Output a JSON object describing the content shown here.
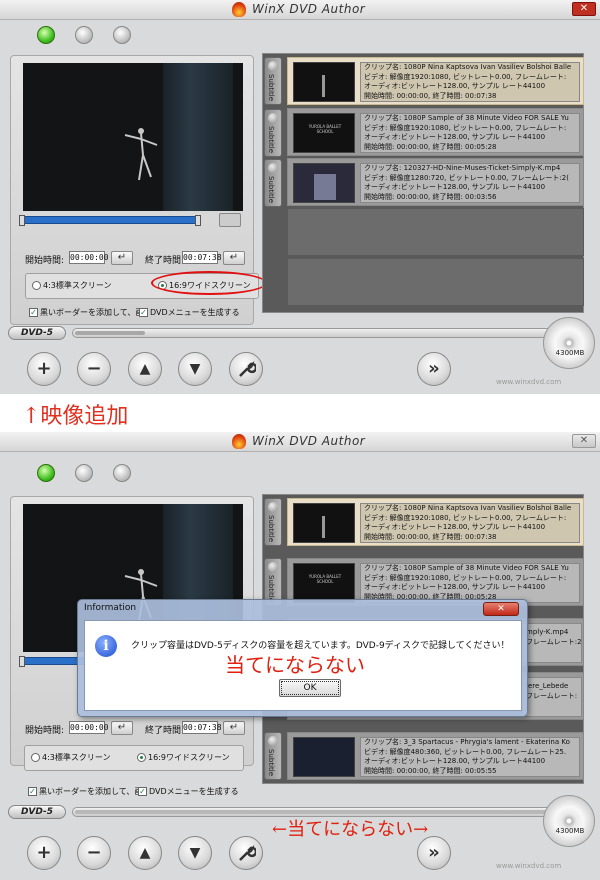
{
  "app_title": "WinX DVD Author",
  "close_glyph": "✕",
  "top": {
    "start_label": "開始時間:",
    "start_value": "00:00:00",
    "end_label": "終了時間:",
    "end_value": "00:07:38",
    "ratio_43": "4:3標準スクリーン",
    "ratio_169": "16:9ワイドスクリーン",
    "ratio_selected": "16:9",
    "check_black_border": "黒いボーダーを添加して、画",
    "check_dvd_menu": "DVDメニューを生成する",
    "dvd_format": "DVD-5",
    "disc_capacity": "4300MB",
    "site": "www.winxdvd.com",
    "subtitle_tab": "Subtitle",
    "clips": [
      {
        "line1": "クリップ名:  1080P Nina Kaptsova Ivan Vasiliev Bolshoi Balle",
        "line2": "ビデオ:  解像度1920:1080, ビットレート0.00, フレームレート:",
        "line3": "オーディオ:ビットレート128.00, サンプル  レート44100",
        "line4": "開始時間:  00:00:00, 終了時間:  00:07:38",
        "thumb_text": ""
      },
      {
        "line1": "クリップ名:  1080P Sample of 38 Minute Video FOR SALE Yu",
        "line2": "ビデオ:  解像度1920:1080, ビットレート0.00, フレームレート:",
        "line3": "オーディオ:ビットレート128.00, サンプル  レート44100",
        "line4": "開始時間:  00:00:00, 終了時間:  00:05:28",
        "thumb_text": "YUROLA BALLET SCHOOL"
      },
      {
        "line1": "クリップ名:  120327-HD-Nine-Muses-Ticket-Simply-K.mp4",
        "line2": "ビデオ:  解像度1280:720, ビットレート0.00, フレームレート:2(",
        "line3": "オーディオ:ビットレート128.00, サンプル  レート44100",
        "line4": "開始時間:  00:00:00, 終了時間:  00:03:56",
        "thumb_text": ""
      }
    ]
  },
  "caption_top": "↑映像追加",
  "bottom": {
    "start_label": "開始時間:",
    "start_value": "00:00:00",
    "end_label": "終了時間:",
    "end_value": "00:07:38",
    "ratio_43": "4:3標準スクリーン",
    "ratio_169": "16:9ワイドスクリーン",
    "check_black_border": "黒いボーダーを添加して、画",
    "check_dvd_menu": "DVDメニューを生成する",
    "dvd_format": "DVD-5",
    "disc_capacity": "4300MB",
    "site": "www.winxdvd.com",
    "subtitle_tab": "Subtitle",
    "clips": [
      {
        "line1": "クリップ名:  1080P Nina Kaptsova Ivan Vasiliev Bolshoi Balle",
        "line2": "ビデオ:  解像度1920:1080, ビットレート0.00, フレームレート:",
        "line3": "オーディオ:ビットレート128.00, サンプル  レート44100",
        "line4": "開始時間:  00:00:00, 終了時間:  00:07:38"
      },
      {
        "line1": "クリップ名:  1080P Sample of 38 Minute Video FOR SALE Yu",
        "line2": "ビデオ:  解像度1920:1080, ビットレート0.00, フレームレート:",
        "line3": "オーディオ:ビットレート128.00, サンプル  レート44100",
        "line4": "開始時間:  00:00:00, 終了時間:  00:05:28",
        "thumb_text": "YUROLA BALLET SCHOOL"
      },
      {
        "line1": "mply-K.mp4",
        "line2": "フレームレート:2!"
      },
      {
        "line1": "lere_Lebede",
        "line2": "フレームレート:"
      },
      {
        "line1": "クリップ名:  3_3 Spartacus - Phrygia's lament - Ekaterina Ko",
        "line2": "ビデオ:  解像度480:360, ビットレート0.00, フレームレート25.",
        "line3": "オーディオ:ビットレート128.00, サンプル  レート44100",
        "line4": "開始時間:  00:00:00, 終了時間:  00:05:55"
      }
    ]
  },
  "dialog": {
    "title": "Information",
    "message": "クリップ容量はDVD-5ディスクの容量を超えています。DVD-9ディスクで記録してください！",
    "ok_label": "OK",
    "icon": "i"
  },
  "note_dialog": "当てにならない",
  "note_arrow": "←当てにならない→",
  "icons": {
    "add": "+",
    "remove": "−",
    "up": "▲",
    "down": "▼",
    "settings": "wrench-icon",
    "next": "»",
    "enter": "↵"
  },
  "colors": {
    "accent_red": "#e02010",
    "seek_blue": "#2a6fc8",
    "led_green": "#40c020"
  }
}
